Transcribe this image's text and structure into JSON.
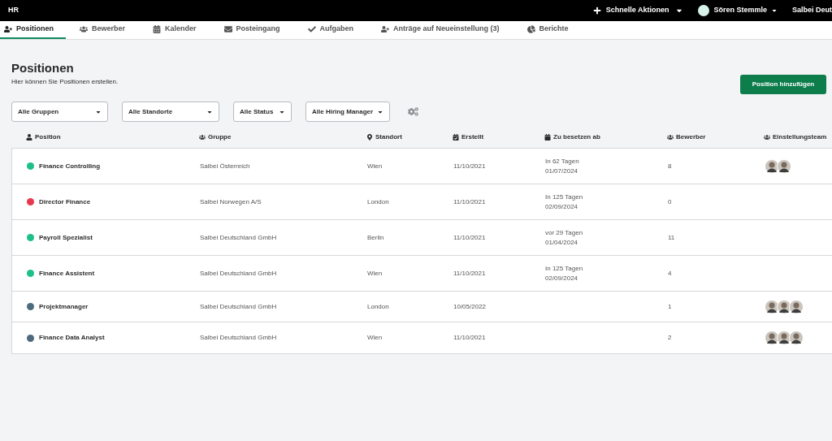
{
  "topbar": {
    "title": "HR",
    "quick_actions": "Schnelle Aktionen",
    "user": "Sören Stemmle",
    "company": "Salbei Deut"
  },
  "tabs": [
    {
      "label": "Positionen",
      "selected": true
    },
    {
      "label": "Bewerber",
      "selected": false
    },
    {
      "label": "Kalender",
      "selected": false
    },
    {
      "label": "Posteingang",
      "selected": false
    },
    {
      "label": "Aufgaben",
      "selected": false
    },
    {
      "label": "Anträge auf Neueinstellung (3)",
      "selected": false
    },
    {
      "label": "Berichte",
      "selected": false
    }
  ],
  "page": {
    "title": "Positionen",
    "subtitle": "Hier können Sie Positionen erstellen.",
    "add_button": "Position hinzufügen"
  },
  "filters": [
    "Alle Gruppen",
    "Alle Standorte",
    "Alle Status",
    "Alle Hiring Manager"
  ],
  "table": {
    "columns": [
      "Position",
      "Gruppe",
      "Standort",
      "Erstellt",
      "Zu besetzen ab",
      "Bewerber",
      "Einstellungsteam"
    ],
    "rows": [
      {
        "color": "#1dbf8a",
        "position": "Finance Controlling",
        "gruppe": "Salbei Österreich",
        "standort": "Wien",
        "erstellt": "11/10/2021",
        "relative": "In 62 Tagen",
        "date": "01/07/2024",
        "bewerber": "8",
        "team": [
          {
            "kind": "avatar"
          },
          {
            "kind": "avatar"
          }
        ]
      },
      {
        "color": "#e8384f",
        "position": "Director Finance",
        "gruppe": "Salbei Norwegen A/S",
        "standort": "London",
        "erstellt": "11/10/2021",
        "relative": "In 125 Tagen",
        "date": "02/09/2024",
        "bewerber": "0"
      },
      {
        "color": "#1dbf8a",
        "position": "Payroll Spezialist",
        "gruppe": "Salbei Deutschland GmbH",
        "standort": "Berlin",
        "erstellt": "11/10/2021",
        "relative": "vor 29 Tagen",
        "date": "01/04/2024",
        "bewerber": "11"
      },
      {
        "color": "#1dbf8a",
        "position": "Finance Assistent",
        "gruppe": "Salbei Deutschland GmbH",
        "standort": "Wien",
        "erstellt": "11/10/2021",
        "relative": "In 125 Tagen",
        "date": "02/09/2024",
        "bewerber": "4"
      },
      {
        "color": "#4e6a7d",
        "position": "Projektmanager",
        "gruppe": "Salbei Deutschland GmbH",
        "standort": "London",
        "erstellt": "10/05/2022",
        "bewerber": "1",
        "team": [
          {
            "kind": "avatar"
          },
          {
            "kind": "avatar"
          },
          {
            "kind": "avatar"
          }
        ]
      },
      {
        "color": "#4e6a7d",
        "position": "Finance Data Analyst",
        "gruppe": "Salbei Deutschland GmbH",
        "standort": "Wien",
        "erstellt": "11/10/2021",
        "bewerber": "2",
        "team": [
          {
            "kind": "avatar"
          },
          {
            "kind": "avatar"
          },
          {
            "kind": "avatar"
          }
        ]
      }
    ]
  }
}
